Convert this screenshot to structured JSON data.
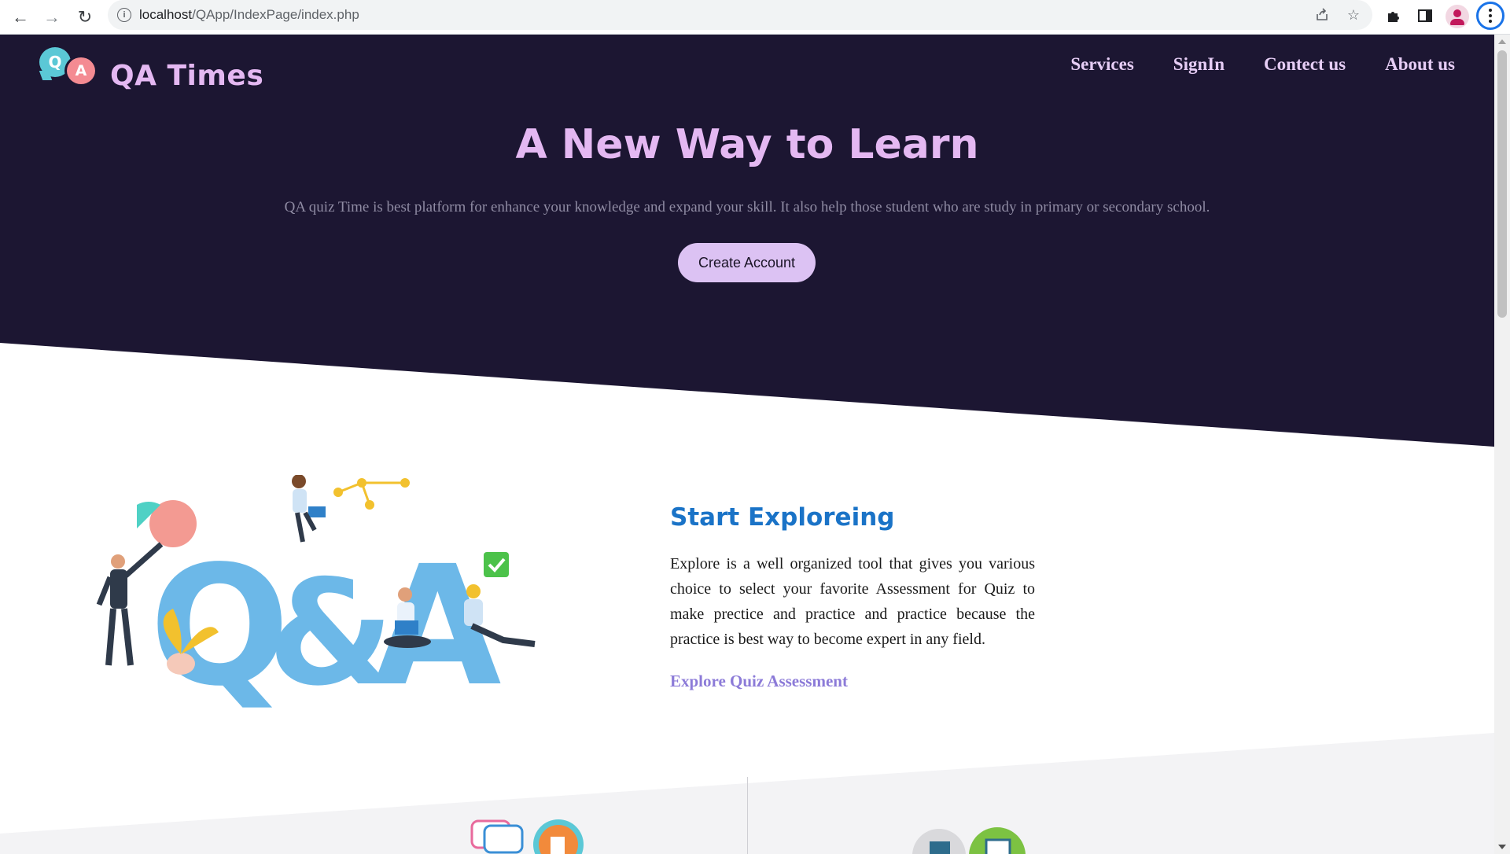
{
  "browser": {
    "url_host": "localhost",
    "url_path": "/QApp/IndexPage/index.php",
    "icons": [
      "back-icon",
      "forward-icon",
      "reload-icon",
      "site-info-icon",
      "share-icon",
      "bookmark-star-icon",
      "extensions-icon",
      "side-panel-icon",
      "profile-avatar-icon",
      "browser-menu-icon"
    ]
  },
  "brand": {
    "logo_q": "Q",
    "logo_a": "A",
    "name": "QA Times"
  },
  "nav": {
    "items": [
      {
        "label": "Services"
      },
      {
        "label": "SignIn"
      },
      {
        "label": "Contect us"
      },
      {
        "label": "About us"
      }
    ]
  },
  "hero": {
    "title": "A New Way to Learn",
    "subtitle": "QA quiz Time is best platform for enhance your knowledge and expand your skill. It also help those student who are study in primary or secondary school.",
    "cta_label": "Create Account"
  },
  "explore": {
    "title": "Start Exploreing",
    "text": "Explore is a well organized tool that gives you various choice to select your favorite Assessment for Quiz to make prectice and practice and practice because the practice is best way to become expert in any field.",
    "link_label": "Explore Quiz Assessment"
  },
  "colors": {
    "hero_bg": "#1c1632",
    "accent_purple": "#e4b8f2",
    "cta_bg": "#dcc2f3",
    "explore_blue": "#1a73c7",
    "link_purple": "#8c7bd8"
  }
}
